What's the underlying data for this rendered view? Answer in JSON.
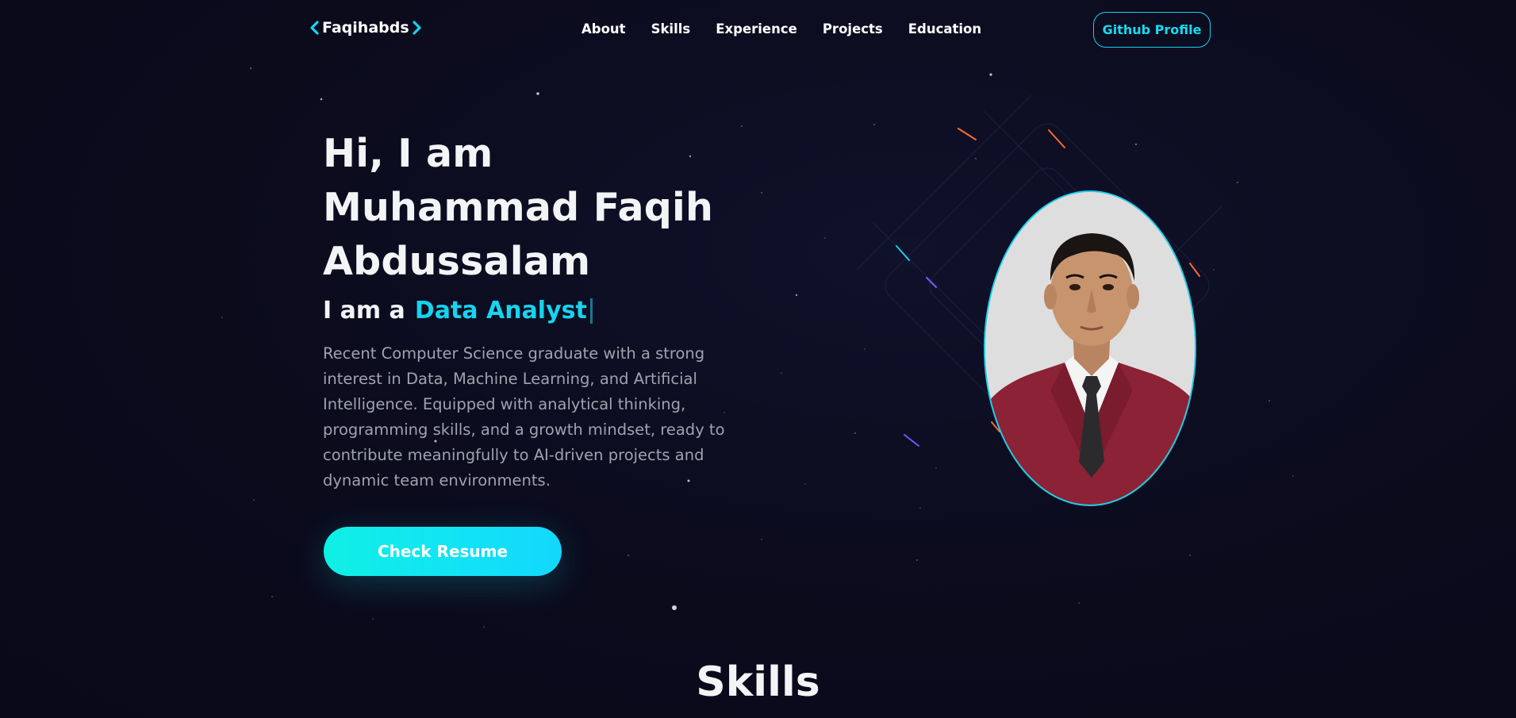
{
  "nav": {
    "brand": "Faqihabds",
    "links": [
      "About",
      "Skills",
      "Experience",
      "Projects",
      "Education"
    ],
    "github_button": "Github Profile"
  },
  "hero": {
    "title_line1": "Hi, I am",
    "title_line2": "Muhammad Faqih",
    "title_line3": "Abdussalam",
    "role_prefix": "I am a",
    "role": "Data Analyst",
    "bio": "Recent Computer Science graduate with a strong interest in Data, Machine Learning, and Artificial Intelligence. Equipped with analytical thinking, programming skills, and a growth mindset, ready to contribute meaningfully to AI-driven projects and dynamic team environments.",
    "resume_button": "Check Resume"
  },
  "sections": {
    "skills_heading": "Skills"
  },
  "colors": {
    "background": "#0b0b1c",
    "accent": "#16d4ef",
    "text": "#f3f4f6",
    "muted_text": "#9fa3ad"
  },
  "icons": {
    "brand_left": "chevron-left-icon",
    "brand_right": "chevron-right-icon"
  }
}
